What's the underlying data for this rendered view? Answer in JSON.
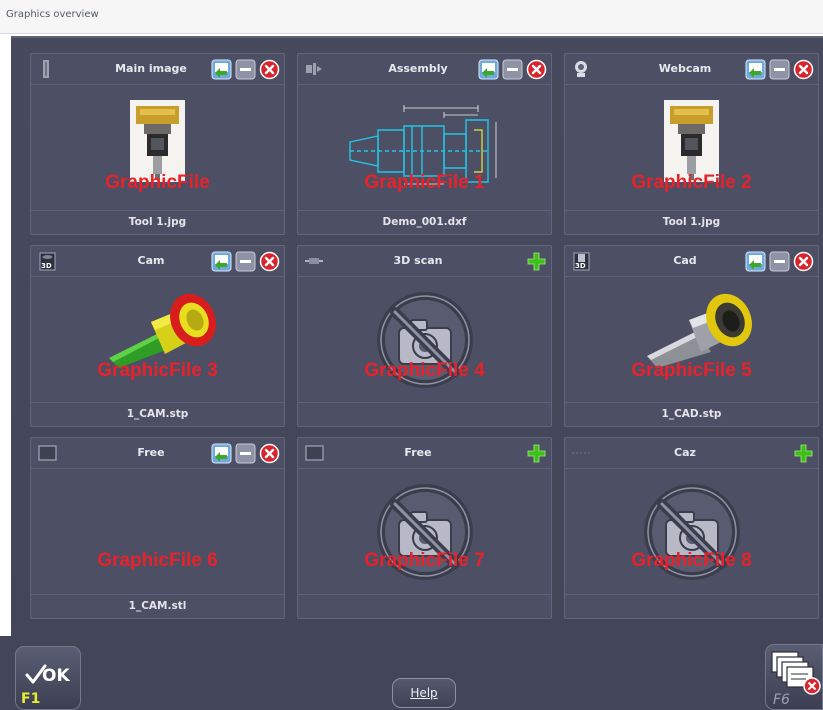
{
  "window": {
    "title": "Graphics overview"
  },
  "tiles": [
    {
      "name": "Main image",
      "graphic_label": "GraphicFile",
      "file": "Tool 1.jpg",
      "actions": [
        "import-icon",
        "minus-icon",
        "delete-icon"
      ],
      "type_icon": "tool-holder-icon",
      "preview": "tool-photo"
    },
    {
      "name": "Assembly",
      "graphic_label": "GraphicFile 1",
      "file": "Demo_001.dxf",
      "actions": [
        "import-icon",
        "minus-icon",
        "delete-icon"
      ],
      "type_icon": "assembly-icon",
      "preview": "dxf-drawing"
    },
    {
      "name": "Webcam",
      "graphic_label": "GraphicFile 2",
      "file": "Tool 1.jpg",
      "actions": [
        "import-icon",
        "minus-icon",
        "delete-icon"
      ],
      "type_icon": "webcam-icon",
      "preview": "tool-photo"
    },
    {
      "name": "Cam",
      "graphic_label": "GraphicFile 3",
      "file": "1_CAM.stp",
      "actions": [
        "import-icon",
        "minus-icon",
        "delete-icon"
      ],
      "type_icon": "3d-cam-icon",
      "preview": "cam-model"
    },
    {
      "name": "3D scan",
      "graphic_label": "GraphicFile 4",
      "file": "",
      "actions": [
        "add-icon"
      ],
      "type_icon": "3d-scan-icon",
      "preview": "no-image"
    },
    {
      "name": "Cad",
      "graphic_label": "GraphicFile 5",
      "file": "1_CAD.stp",
      "actions": [
        "import-icon",
        "minus-icon",
        "delete-icon"
      ],
      "type_icon": "3d-cad-icon",
      "preview": "cad-model"
    },
    {
      "name": "Free",
      "graphic_label": "GraphicFile 6",
      "file": "1_CAM.stl",
      "actions": [
        "import-icon",
        "minus-icon",
        "delete-icon"
      ],
      "type_icon": "free-frame-icon",
      "preview": "none"
    },
    {
      "name": "Free",
      "graphic_label": "GraphicFile 7",
      "file": "",
      "actions": [
        "add-icon"
      ],
      "type_icon": "free-frame-icon",
      "preview": "no-image"
    },
    {
      "name": "Caz",
      "graphic_label": "GraphicFile 8",
      "file": "",
      "actions": [
        "add-icon"
      ],
      "type_icon": "caz-icon",
      "preview": "no-image"
    }
  ],
  "footer": {
    "ok_label": "OK",
    "ok_key": "F1",
    "help_label": "Help",
    "f6_key": "F6"
  },
  "colors": {
    "panel": "#4d5064",
    "background": "#434659",
    "graphic_label": "#e8222b",
    "accent_yellow": "#e6ec32",
    "add_green": "#3fbe1c"
  }
}
